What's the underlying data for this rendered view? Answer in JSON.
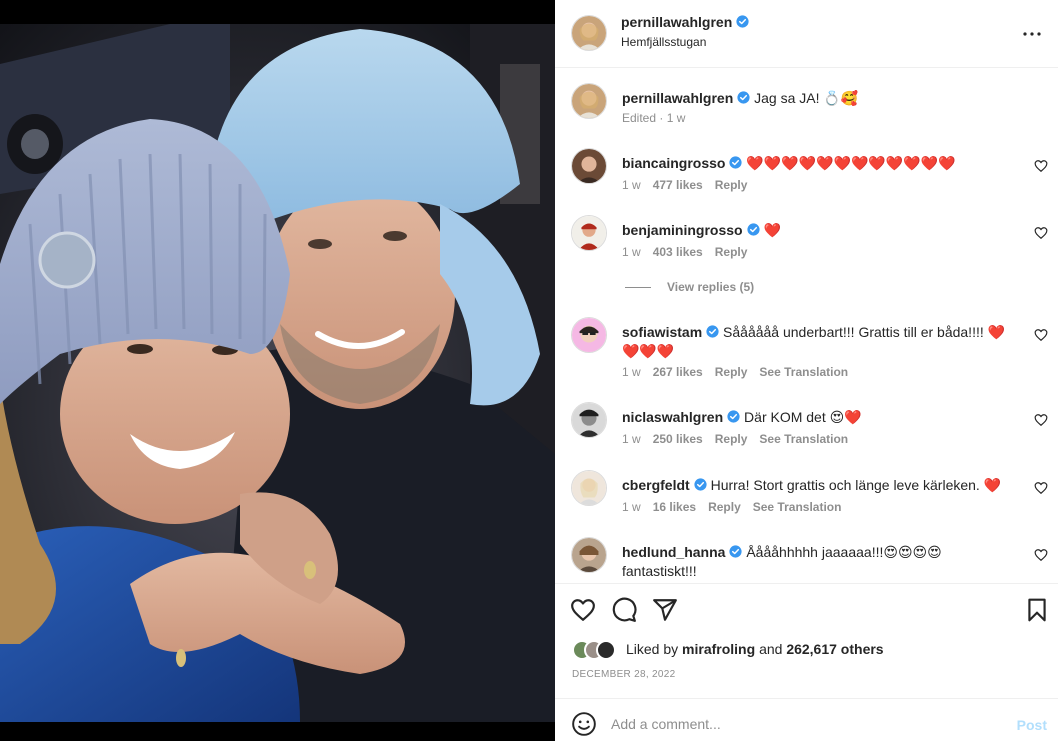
{
  "post": {
    "author": "pernillawahlgren",
    "location": "Hemfjällsstugan",
    "verified_color": "#3897f0"
  },
  "caption": {
    "username": "pernillawahlgren",
    "text": "Jag sa JA! 💍🥰",
    "meta": "Edited · 1 w"
  },
  "comments": [
    {
      "username": "biancaingrosso",
      "text": "❤️❤️❤️❤️❤️❤️❤️❤️❤️❤️❤️❤️",
      "time": "1 w",
      "likes": "477 likes",
      "reply": "Reply",
      "translation": ""
    },
    {
      "username": "benjaminingrosso",
      "text": "❤️",
      "time": "1 w",
      "likes": "403 likes",
      "reply": "Reply",
      "translation": ""
    },
    {
      "username": "sofiawistam",
      "text": "Såååååå underbart!!! Grattis till er båda!!!! ❤️❤️❤️❤️",
      "time": "1 w",
      "likes": "267 likes",
      "reply": "Reply",
      "translation": "See Translation"
    },
    {
      "username": "niclaswahlgren",
      "text": "Där KOM det 😍❤️",
      "time": "1 w",
      "likes": "250 likes",
      "reply": "Reply",
      "translation": "See Translation"
    },
    {
      "username": "cbergfeldt",
      "text": "Hurra! Stort grattis och länge leve kärleken. ❤️",
      "time": "1 w",
      "likes": "16 likes",
      "reply": "Reply",
      "translation": "See Translation"
    },
    {
      "username": "hedlund_hanna",
      "text": "Ååååhhhhh jaaaaaa!!!😍😍😍😍 fantastiskt!!!",
      "time": "",
      "likes": "",
      "reply": "",
      "translation": ""
    }
  ],
  "view_replies": "View replies (5)",
  "likes": {
    "prefix": "Liked by",
    "user": "mirafroling",
    "and": "and",
    "others": "262,617 others"
  },
  "date": "DECEMBER 28, 2022",
  "add_comment": {
    "placeholder": "Add a comment...",
    "post_label": "Post"
  }
}
